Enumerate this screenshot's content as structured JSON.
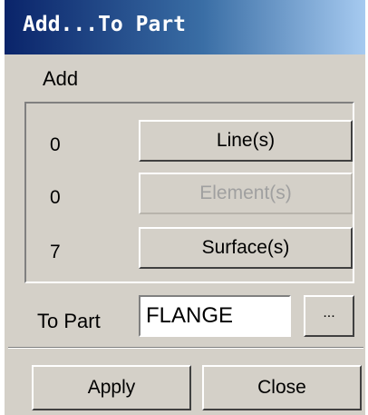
{
  "window": {
    "title": "Add...To Part"
  },
  "add_section": {
    "label": "Add",
    "rows": [
      {
        "count": "0",
        "button_label": "Line(s)",
        "enabled": true
      },
      {
        "count": "0",
        "button_label": "Element(s)",
        "enabled": false
      },
      {
        "count": "7",
        "button_label": "Surface(s)",
        "enabled": true
      }
    ]
  },
  "to_part": {
    "label": "To Part",
    "value": "FLANGE",
    "browse_label": "..."
  },
  "footer": {
    "apply_label": "Apply",
    "close_label": "Close"
  }
}
